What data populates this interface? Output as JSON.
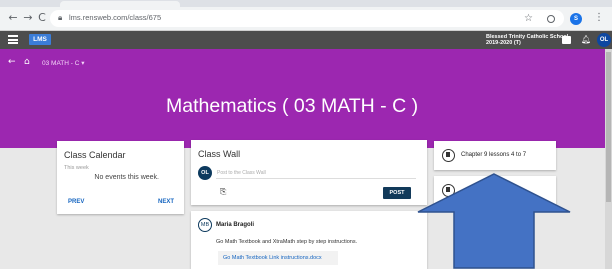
{
  "browser": {
    "back": "←",
    "forward": "→",
    "reload": "C",
    "url": "lms.rensweb.com/class/675",
    "star": "☆",
    "profile": "S",
    "menu": "⋮"
  },
  "header": {
    "logo": "LMS",
    "school_line1": "Blessed Trinity Catholic School",
    "school_line2": "2019-2020 (T)",
    "user_initials": "OL"
  },
  "banner": {
    "breadcrumb": "03 MATH - C ▾",
    "title": "Mathematics ( 03 MATH - C )",
    "color": "#9c27b0"
  },
  "calendar": {
    "title": "Class Calendar",
    "subtitle": "This week",
    "empty_text": "No events this week.",
    "prev": "PREV",
    "next": "NEXT"
  },
  "wall": {
    "title": "Class Wall",
    "avatar": "OL",
    "placeholder": "Post to the Class Wall",
    "attach": "⎘",
    "post_button": "POST"
  },
  "post": {
    "avatar": "MB",
    "author": "Maria Bragoli",
    "body": "Go Math Textbook and XtraMath step by step instructions.",
    "link": "Go Math Textbook Link instructions.docx"
  },
  "resources": {
    "item1": "Chapter 9 lessons 4 to 7",
    "item2": ""
  },
  "overlay": {
    "arrow_color": "#4472c4",
    "arrow_stroke": "#2f528f"
  }
}
